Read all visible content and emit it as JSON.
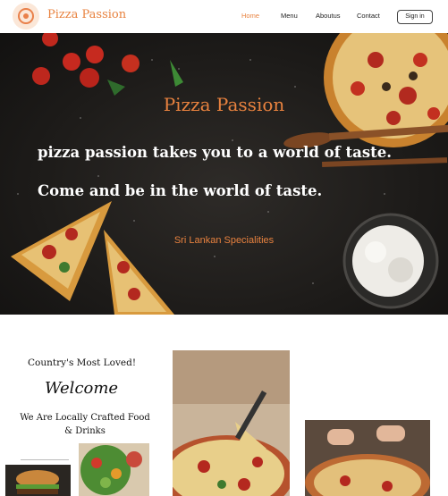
{
  "nav": {
    "brand": "Pizza Passion",
    "items": [
      {
        "label": "Home",
        "active": true
      },
      {
        "label": "Menu",
        "active": false
      },
      {
        "label": "Aboutus",
        "active": false
      },
      {
        "label": "Contact",
        "active": false
      }
    ],
    "signin_label": "Sign in"
  },
  "hero": {
    "title": "Pizza Passion",
    "line1": "pizza passion takes you to a world of taste.",
    "line2": "Come and be in the world of taste.",
    "subtitle": "Sri Lankan Specialities"
  },
  "intro": {
    "heading": "Country's Most Loved!",
    "welcome": "Welcome",
    "crafted": "We Are Locally Crafted Food & Drinks"
  },
  "colors": {
    "accent": "#e8823f",
    "hero_bg": "#1d1b19"
  }
}
